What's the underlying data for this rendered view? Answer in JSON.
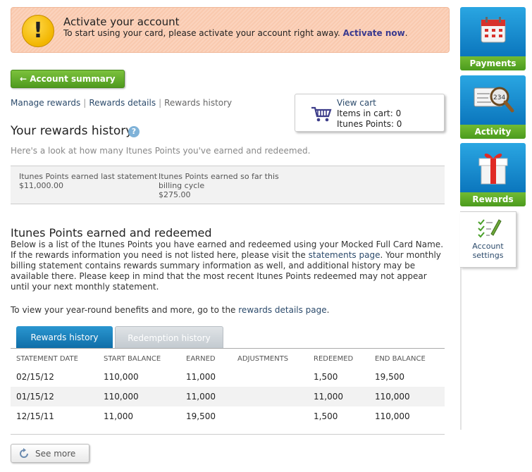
{
  "alert": {
    "title": "Activate your account",
    "text": "To start using your card, please activate your account right away.",
    "link": "Activate now",
    "period": ".",
    "icon": "exclamation-icon",
    "glyph": "!"
  },
  "account_summary_button": {
    "label": "Account summary",
    "arrow": "🡐"
  },
  "breadcrumbs": {
    "manage": "Manage rewards",
    "details": "Rewards details",
    "history": "Rewards history",
    "sep": "|"
  },
  "cart": {
    "view": "View cart",
    "items": "Items in cart: 0",
    "points": "Itunes Points: 0",
    "icon": "cart-icon"
  },
  "page": {
    "title": "Your rewards history",
    "help_glyph": "?",
    "intro": "Here's a look at how many Itunes Points you've earned and redeemed."
  },
  "stats": {
    "last_label": "Itunes Points earned last statement",
    "last_value": "$11,000.00",
    "current_label": "Itunes Points earned so far this billing cycle",
    "current_value": "$275.00"
  },
  "section": {
    "title": "Itunes Points earned and redeemed",
    "para_1": "Below is a list of the Itunes Points you have earned and redeemed using your Mocked Full Card Name. If the rewards information you need is not listed here, please visit the",
    "para_link": "statements page",
    "para_2": ". Your monthly billing statement contains rewards summary information as well, and additional history may be available there. Please keep in mind that the most recent Itunes Points redeemed may not appear until your next monthly statement.",
    "benefits_1": "To view your year-round benefits and more, go to the",
    "benefits_link": "rewards details page",
    "benefits_2": "."
  },
  "tabs": {
    "active": "Rewards history",
    "inactive": "Redemption history"
  },
  "table": {
    "headers": [
      "STATEMENT DATE",
      "START BALANCE",
      "EARNED",
      "ADJUSTMENTS",
      "REDEEMED",
      "END BALANCE"
    ],
    "rows": [
      [
        "02/15/12",
        "110,000",
        "11,000",
        "",
        "1,500",
        "19,500"
      ],
      [
        "01/15/12",
        "110,000",
        "11,000",
        "",
        "11,000",
        "110,000"
      ],
      [
        "12/15/11",
        "11,000",
        "19,500",
        "",
        "1,500",
        "110,000"
      ]
    ]
  },
  "see_more": {
    "label": "See more",
    "icon": "refresh-icon"
  },
  "sidebar": {
    "payments": "Payments",
    "activity": "Activity",
    "activity_badge": "234",
    "rewards": "Rewards",
    "settings_1": "Account",
    "settings_2": "settings"
  },
  "colors": {
    "accent_green": "#5aa625",
    "accent_blue": "#1b86c6",
    "alert_bg": "#fbd3bd",
    "link": "#2b4a6b"
  }
}
